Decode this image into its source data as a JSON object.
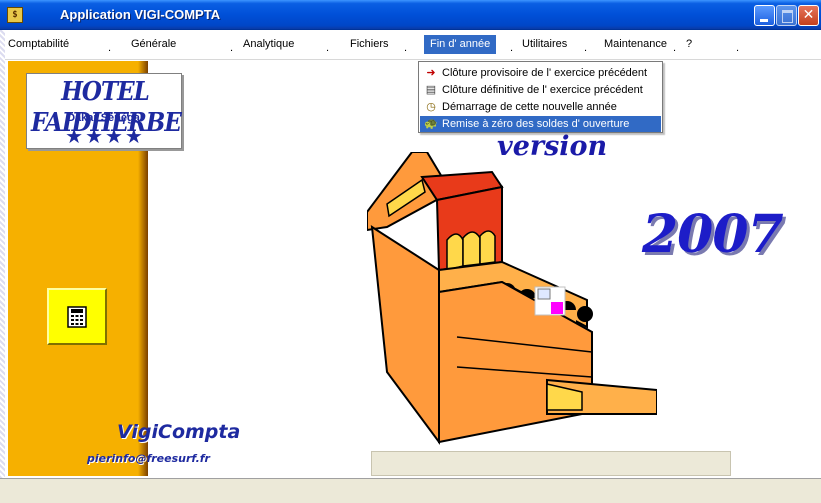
{
  "window": {
    "title": "Application VIGI-COMPTA",
    "icon": "app-icon"
  },
  "menu": [
    {
      "label": "Comptabilité"
    },
    {
      "label": "Générale"
    },
    {
      "label": "Analytique"
    },
    {
      "label": "Fichiers"
    },
    {
      "label": "Fin d' année",
      "active": true
    },
    {
      "label": "Utilitaires"
    },
    {
      "label": "Maintenance"
    },
    {
      "label": "?"
    }
  ],
  "dropdown": [
    {
      "label": "Clôture provisoire de l' exercice précédent",
      "icon": "exit-arrow-icon"
    },
    {
      "label": "Clôture définitive de l' exercice précédent",
      "icon": "archive-icon"
    },
    {
      "label": "Démarrage de cette nouvelle année",
      "icon": "clock-icon"
    },
    {
      "label": "Remise à zéro des soldes d' ouverture",
      "icon": "turtle-icon",
      "highlighted": true
    }
  ],
  "logo": {
    "name": "HOTEL FAIDHERBE",
    "sub": "Dakar Sénégal",
    "stars": "★★★★"
  },
  "brand": {
    "name": "VigiCompta",
    "email": "pierinfo@freesurf.fr"
  },
  "splash": {
    "version_label": "version",
    "year": "2007"
  },
  "colors": {
    "titlebar": "#0050d8",
    "menu_highlight": "#316ac5",
    "side_panel": "#f6b000",
    "brand_blue": "#1e2aa0"
  }
}
